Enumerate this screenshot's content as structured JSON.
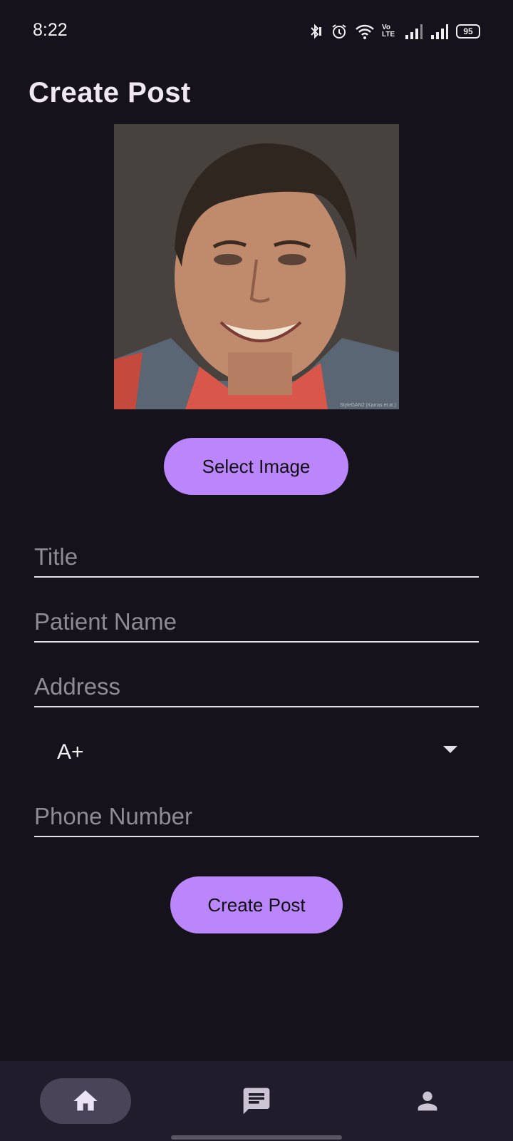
{
  "status_bar": {
    "time": "8:22",
    "icons": [
      "bluetooth-icon",
      "alarm-icon",
      "wifi-icon",
      "volte-icon",
      "signal-icon",
      "signal-icon",
      "battery-icon"
    ],
    "volte_label": "Vo LTE",
    "battery": "95"
  },
  "page": {
    "title": "Create Post",
    "photo_watermark": "StyleGAN2 (Karras et al.)"
  },
  "buttons": {
    "select_image": "Select Image",
    "create_post": "Create Post"
  },
  "form": {
    "title_placeholder": "Title",
    "patient_name_placeholder": "Patient Name",
    "address_placeholder": "Address",
    "blood_group_value": "A+",
    "phone_placeholder": "Phone Number"
  },
  "bottom_nav": {
    "items": [
      "home-icon",
      "chat-icon",
      "person-icon"
    ],
    "active": "home-icon"
  },
  "colors": {
    "background": "#16121c",
    "accent": "#bb86fc",
    "nav_background": "#211c2b",
    "nav_active_pill": "#4a4458"
  }
}
